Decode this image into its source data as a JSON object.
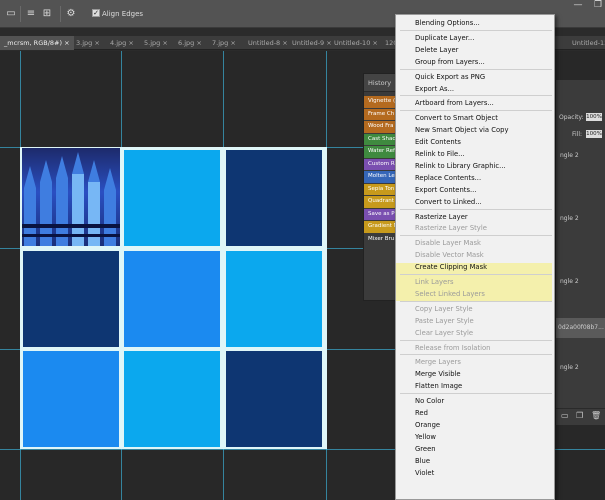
{
  "options_bar": {
    "checkbox_label": "Align Edges",
    "checkbox_checked": true,
    "icons": [
      "combine-shapes-icon",
      "path-alignment-icon",
      "path-arrangement-icon",
      "gear-icon"
    ],
    "window_controls": [
      "minimize-icon",
      "restore-icon"
    ]
  },
  "tabs": [
    {
      "label": "_mcrsm, RGB/8#) ×",
      "active": true
    },
    {
      "label": "3.jpg ×"
    },
    {
      "label": "4.jpg ×"
    },
    {
      "label": "5.jpg ×"
    },
    {
      "label": "6.jpg ×"
    },
    {
      "label": "7.jpg ×"
    },
    {
      "label": "Untitled-8 ×"
    },
    {
      "label": "Untitled-9 ×"
    },
    {
      "label": "Untitled-10 ×"
    },
    {
      "label": "120"
    },
    {
      "label": "Untitled-12"
    }
  ],
  "history_panel": {
    "title": "History",
    "items": [
      {
        "label": "Vignette (",
        "color": "#b46a1f"
      },
      {
        "label": "Frame Ch",
        "color": "#b46a1f"
      },
      {
        "label": "Wood Fra",
        "color": "#b46a1f"
      },
      {
        "label": "Cast Shac",
        "color": "#3f8a3f"
      },
      {
        "label": "Water Ref",
        "color": "#3f8a3f"
      },
      {
        "label": "Custom R",
        "color": "#7a4fb0"
      },
      {
        "label": "Molten Le",
        "color": "#3566b8"
      },
      {
        "label": "Sepia Ton",
        "color": "#c79a1c"
      },
      {
        "label": "Quadrant",
        "color": "#c79a1c"
      },
      {
        "label": "Save as P",
        "color": "#7a4fb0"
      },
      {
        "label": "Gradient M",
        "color": "#c79a1c"
      },
      {
        "label": "Mixer Bru",
        "color": "#3b3b3b"
      }
    ]
  },
  "layers_panel": {
    "opacity_label": "Opacity:",
    "opacity_value": "100%",
    "fill_label": "Fill:",
    "fill_value": "100%",
    "layer_names": [
      "ngle 2",
      "ngle 2",
      "ngle 2",
      "ngle 2"
    ],
    "selected_layer": "0d2a00f08b7..."
  },
  "context_menu": {
    "items": [
      {
        "label": "Blending Options...",
        "enabled": true
      },
      {
        "sep": true
      },
      {
        "label": "Duplicate Layer...",
        "enabled": true
      },
      {
        "label": "Delete Layer",
        "enabled": true
      },
      {
        "label": "Group from Layers...",
        "enabled": true
      },
      {
        "sep": true
      },
      {
        "label": "Quick Export as PNG",
        "enabled": true
      },
      {
        "label": "Export As...",
        "enabled": true
      },
      {
        "sep": true
      },
      {
        "label": "Artboard from Layers...",
        "enabled": true
      },
      {
        "sep": true
      },
      {
        "label": "Convert to Smart Object",
        "enabled": true
      },
      {
        "label": "New Smart Object via Copy",
        "enabled": true
      },
      {
        "label": "Edit Contents",
        "enabled": true
      },
      {
        "label": "Relink to File...",
        "enabled": true
      },
      {
        "label": "Relink to Library Graphic...",
        "enabled": true
      },
      {
        "label": "Replace Contents...",
        "enabled": true
      },
      {
        "label": "Export Contents...",
        "enabled": true
      },
      {
        "label": "Convert to Linked...",
        "enabled": true
      },
      {
        "sep": true
      },
      {
        "label": "Rasterize Layer",
        "enabled": true
      },
      {
        "label": "Rasterize Layer Style",
        "enabled": false
      },
      {
        "sep": true
      },
      {
        "label": "Disable Layer Mask",
        "enabled": false
      },
      {
        "label": "Disable Vector Mask",
        "enabled": false
      },
      {
        "label": "Create Clipping Mask",
        "enabled": true
      },
      {
        "sep": true
      },
      {
        "label": "Link Layers",
        "enabled": false
      },
      {
        "label": "Select Linked Layers",
        "enabled": false
      },
      {
        "sep": true
      },
      {
        "label": "Copy Layer Style",
        "enabled": false
      },
      {
        "label": "Paste Layer Style",
        "enabled": false
      },
      {
        "label": "Clear Layer Style",
        "enabled": false
      },
      {
        "sep": true
      },
      {
        "label": "Release from Isolation",
        "enabled": false
      },
      {
        "sep": true
      },
      {
        "label": "Merge Layers",
        "enabled": false
      },
      {
        "label": "Merge Visible",
        "enabled": true
      },
      {
        "label": "Flatten Image",
        "enabled": true
      },
      {
        "sep": true
      },
      {
        "label": "No Color",
        "enabled": true
      },
      {
        "label": "Red",
        "enabled": true
      },
      {
        "label": "Orange",
        "enabled": true
      },
      {
        "label": "Yellow",
        "enabled": true
      },
      {
        "label": "Green",
        "enabled": true
      },
      {
        "label": "Blue",
        "enabled": true
      },
      {
        "label": "Violet",
        "enabled": true
      }
    ]
  },
  "canvas_colors": {
    "navy": "#0e3672",
    "sky": "#0ba8ee",
    "blue": "#1b8af0"
  }
}
